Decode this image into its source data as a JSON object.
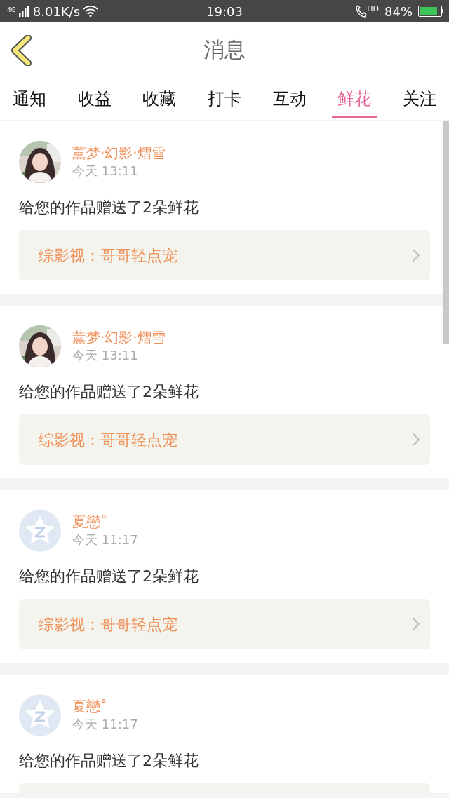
{
  "status_bar": {
    "network": "4G",
    "speed": "8.01K/s",
    "time": "19:03",
    "call_badge": "HD",
    "battery": "84%"
  },
  "header": {
    "title": "消息"
  },
  "tabs": [
    {
      "label": "通知",
      "selected": false
    },
    {
      "label": "收益",
      "selected": false
    },
    {
      "label": "收藏",
      "selected": false
    },
    {
      "label": "打卡",
      "selected": false
    },
    {
      "label": "互动",
      "selected": false
    },
    {
      "label": "鲜花",
      "selected": true
    },
    {
      "label": "关注",
      "selected": false
    }
  ],
  "messages": [
    {
      "kind": "picture",
      "name": "薰梦·幻影·熠雪",
      "time": "今天 13:11",
      "text": "给您的作品赠送了2朵鲜花",
      "work": "综影视：哥哥轻点宠"
    },
    {
      "kind": "picture",
      "name": "薰梦·幻影·熠雪",
      "time": "今天 13:11",
      "text": "给您的作品赠送了2朵鲜花",
      "work": "综影视：哥哥轻点宠"
    },
    {
      "kind": "icon",
      "name": "夏戀˚",
      "time": "今天 11:17",
      "text": "给您的作品赠送了2朵鲜花",
      "work": "综影视：哥哥轻点宠"
    },
    {
      "kind": "icon",
      "name": "夏戀˚",
      "time": "今天 11:17",
      "text": "给您的作品赠送了2朵鲜花"
    }
  ]
}
